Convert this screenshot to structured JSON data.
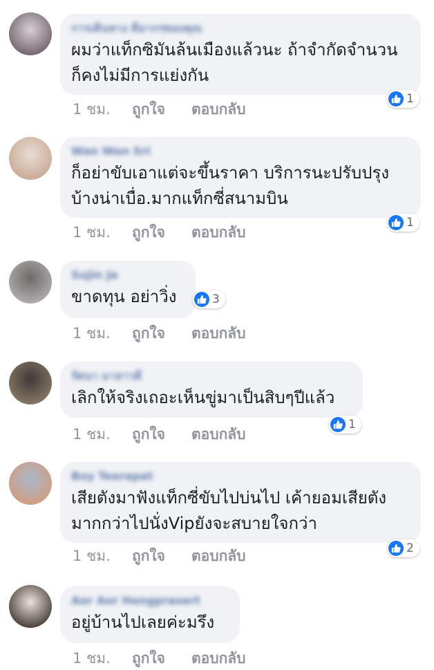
{
  "comments": [
    {
      "author": "การเดินทาง ดีมากๆของคุณ",
      "lines": [
        "ผมว่าแท็กซิมันล้นเมืองแล้วนะ ถ้าจำกัดจำนวน",
        "ก็คงไม่มีการแย่งกัน"
      ],
      "likes": "1",
      "time": "1 ชม.",
      "like_label": "ถูกใจ",
      "reply_label": "ตอบกลับ",
      "avatar_colors": [
        "#6b5a63",
        "#d5cfd6"
      ]
    },
    {
      "author": "Wan Wan Sri",
      "lines": [
        "ก็อย่าขับเอาแต่จะขึ้นราคา  บริการนะปรับปรุง",
        "บ้างน่าเบื่อ.มากแท็กซี่สนามบิน"
      ],
      "likes": "1",
      "time": "1 ชม.",
      "like_label": "ถูกใจ",
      "reply_label": "ตอบกลับ",
      "avatar_colors": [
        "#c7a58f",
        "#e8dcd4"
      ]
    },
    {
      "author": "Sujin Ja",
      "lines": [
        "ขาดทุน อย่าวิ่ง"
      ],
      "likes": "3",
      "time": "1 ชม.",
      "like_label": "ถูกใจ",
      "reply_label": "ตอบกลับ",
      "avatar_colors": [
        "#b8b4b3",
        "#6e6a69"
      ]
    },
    {
      "author": "รัตนา มาลาวดี",
      "lines": [
        "เลิกให้จริงเถอะเห็นขู่มาเป็นสิบๆปีแล้ว"
      ],
      "likes": "1",
      "time": "1 ชม.",
      "like_label": "ถูกใจ",
      "reply_label": "ตอบกลับ",
      "avatar_colors": [
        "#8f7d6b",
        "#3f3a36"
      ]
    },
    {
      "author": "Boy Teerapat",
      "lines": [
        "เสียตังมาฟังแท็กซี่ขับไปบ่นไป เค้ายอมเสียตัง",
        "มากกว่าไปนั่งVipยังจะสบายใจกว่า"
      ],
      "likes": "2",
      "time": "1 ชม.",
      "like_label": "ถูกใจ",
      "reply_label": "ตอบกลับ",
      "avatar_colors": [
        "#d49a7a",
        "#a9b8c9"
      ]
    },
    {
      "author": "Aor Aor Hengprasert",
      "lines": [
        "อยู่บ้านไปเลยค่ะมรึง"
      ],
      "likes": "",
      "time": "1 ชม.",
      "like_label": "ถูกใจ",
      "reply_label": "ตอบกลับ",
      "avatar_colors": [
        "#3a2f29",
        "#e9e2dc"
      ]
    }
  ]
}
